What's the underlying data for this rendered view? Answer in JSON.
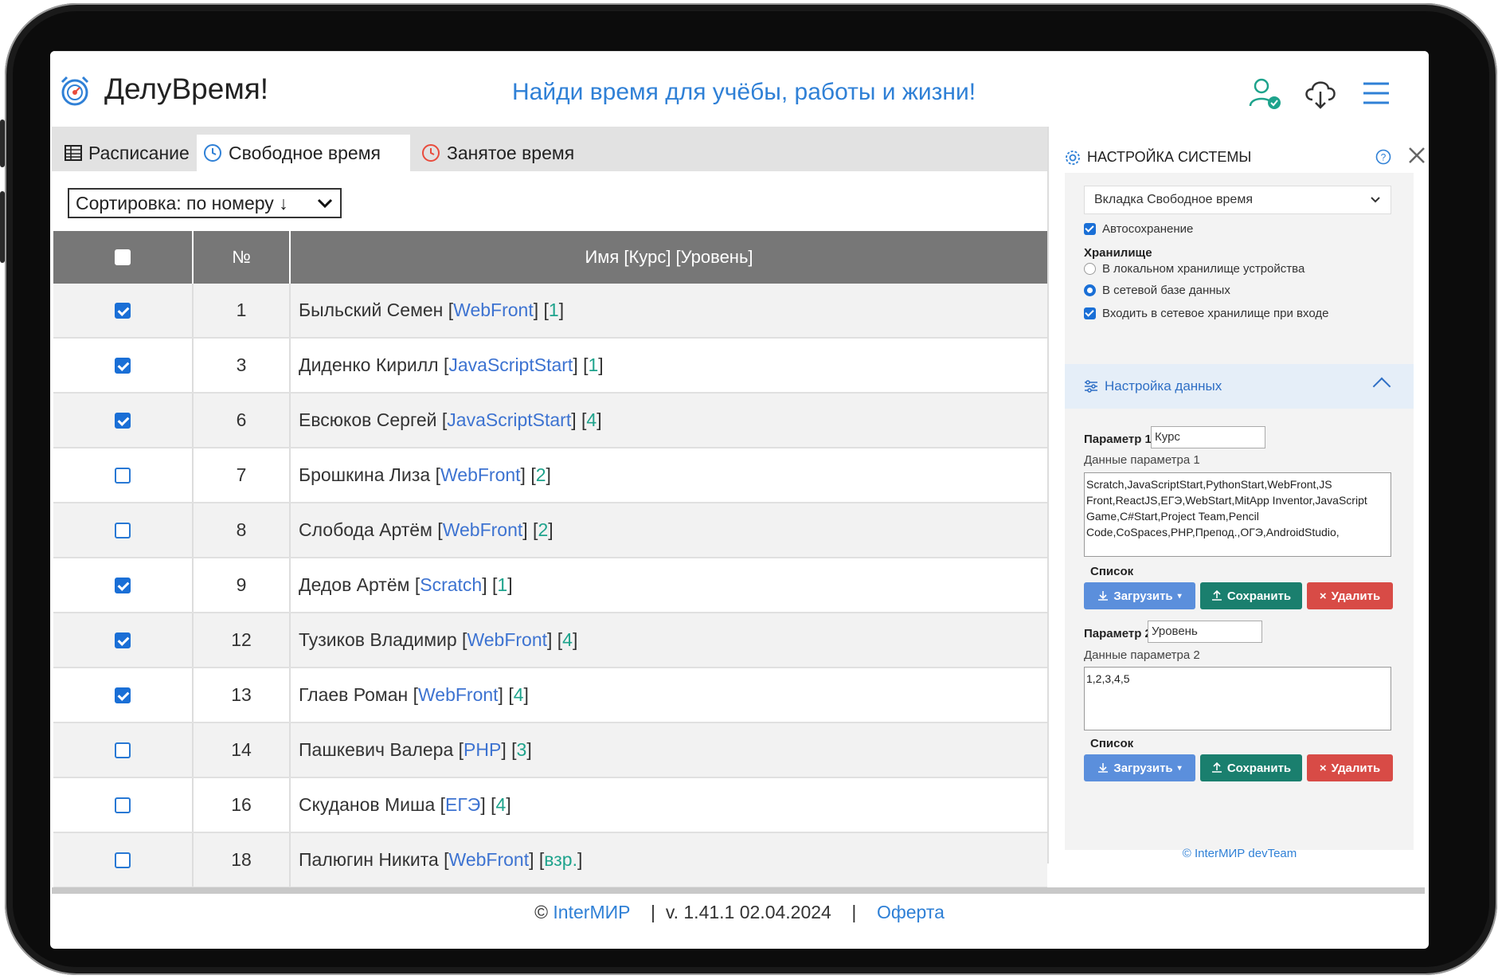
{
  "app": {
    "name": "ДелуВремя!",
    "slogan": "Найди время для учёбы, работы и жизни!"
  },
  "tabs": [
    {
      "label": "Расписание",
      "icon": "table-icon"
    },
    {
      "label": "Свободное время",
      "icon": "clock-icon",
      "active": true
    },
    {
      "label": "Занятое время",
      "icon": "clock-red-icon"
    }
  ],
  "sort": {
    "label": "Сортировка: по номеру ↓"
  },
  "table": {
    "headers": {
      "num": "№",
      "name": "Имя [Курс] [Уровень]"
    },
    "rows": [
      {
        "checked": true,
        "num": "1",
        "name": "Быльский Семен",
        "course": "WebFront",
        "level": "1"
      },
      {
        "checked": true,
        "num": "3",
        "name": "Диденко Кирилл",
        "course": "JavaScriptStart",
        "level": "1"
      },
      {
        "checked": true,
        "num": "6",
        "name": "Евсюков Сергей",
        "course": "JavaScriptStart",
        "level": "4"
      },
      {
        "checked": false,
        "num": "7",
        "name": "Брошкина Лиза",
        "course": "WebFront",
        "level": "2"
      },
      {
        "checked": false,
        "num": "8",
        "name": "Слобода Артём",
        "course": "WebFront",
        "level": "2"
      },
      {
        "checked": true,
        "num": "9",
        "name": "Дедов Артём",
        "course": "Scratch",
        "level": "1"
      },
      {
        "checked": true,
        "num": "12",
        "name": "Тузиков Владимир",
        "course": "WebFront",
        "level": "4"
      },
      {
        "checked": true,
        "num": "13",
        "name": "Глаев Роман",
        "course": "WebFront",
        "level": "4"
      },
      {
        "checked": false,
        "num": "14",
        "name": "Пашкевич Валера",
        "course": "PHP",
        "level": "3"
      },
      {
        "checked": false,
        "num": "16",
        "name": "Скуданов Миша",
        "course": "ЕГЭ",
        "level": "4"
      },
      {
        "checked": false,
        "num": "18",
        "name": "Палюгин Никита",
        "course": "WebFront",
        "level": "взр."
      }
    ]
  },
  "footer": {
    "copyright": "©",
    "org": "InterМИР",
    "sep1": "|",
    "version": "v. 1.41.1  02.04.2024",
    "sep2": "|",
    "offer": "Оферта"
  },
  "settings": {
    "title": "НАСТРОЙКА СИСТЕМЫ",
    "default_tab": "Вкладка Свободное время",
    "autosave": "Автосохранение",
    "storage_title": "Хранилище",
    "storage_local": "В локальном хранилище устройства",
    "storage_net": "В сетевой базе данных",
    "net_login": "Входить в сетевое хранилище при входе",
    "data_section": "Настройка данных",
    "param1_label": "Параметр 1.",
    "param1_value": "Курс",
    "param1_data_label": "Данные параметра 1",
    "param1_data": "Scratch,JavaScriptStart,PythonStart,WebFront,JS Front,ReactJS,ЕГЭ,WebStart,MitApp Inventor,JavaScript Game,C#Start,Project Team,Pencil Code,CoSpaces,PHP,Препод.,ОГЭ,AndroidStudio,",
    "list_label": "Список",
    "btn_load": "Загрузить",
    "btn_save": "Сохранить",
    "btn_delete": "Удалить",
    "param2_label": "Параметр 2.",
    "param2_value": "Уровень",
    "param2_data_label": "Данные параметра 2",
    "param2_data": "1,2,3,4,5",
    "list2_label": "Список",
    "copyright": "© InterМИР devTeam"
  },
  "colors": {
    "accent": "#2f80d6",
    "checkbox": "#1a6fd6",
    "level": "#1ea38c",
    "btn_load": "#5b8fdc",
    "btn_save": "#1a7f6e",
    "btn_delete": "#d84b46"
  }
}
